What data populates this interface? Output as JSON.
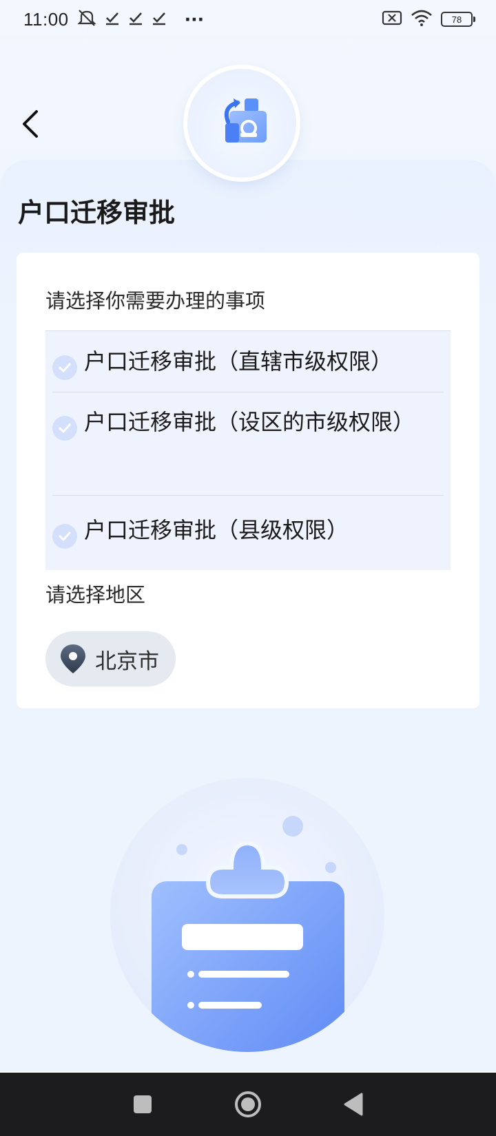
{
  "status_bar": {
    "time": "11:00",
    "notification_icons": [
      "mute-icon",
      "check-icon",
      "check-icon",
      "check-icon"
    ],
    "more": "···",
    "battery": "78"
  },
  "header": {
    "back_icon": "chevron-left-icon",
    "badge_icon": "migration-app-icon"
  },
  "page": {
    "title": "户口迁移审批"
  },
  "matters": {
    "label": "请选择你需要办理的事项",
    "options": [
      {
        "label": "户口迁移审批（直辖市级权限）"
      },
      {
        "label": "户口迁移审批（设区的市级权限）"
      },
      {
        "label": "户口迁移审批（县级权限）"
      }
    ]
  },
  "region": {
    "label": "请选择地区",
    "selected": "北京市",
    "icon": "location-pin-icon"
  },
  "colors": {
    "accent": "#5b87f5",
    "background": "#eef4fd",
    "navbar": "#1c1c1e"
  },
  "navbar": {
    "icons": [
      "recent-apps-icon",
      "home-icon",
      "back-triangle-icon"
    ]
  }
}
